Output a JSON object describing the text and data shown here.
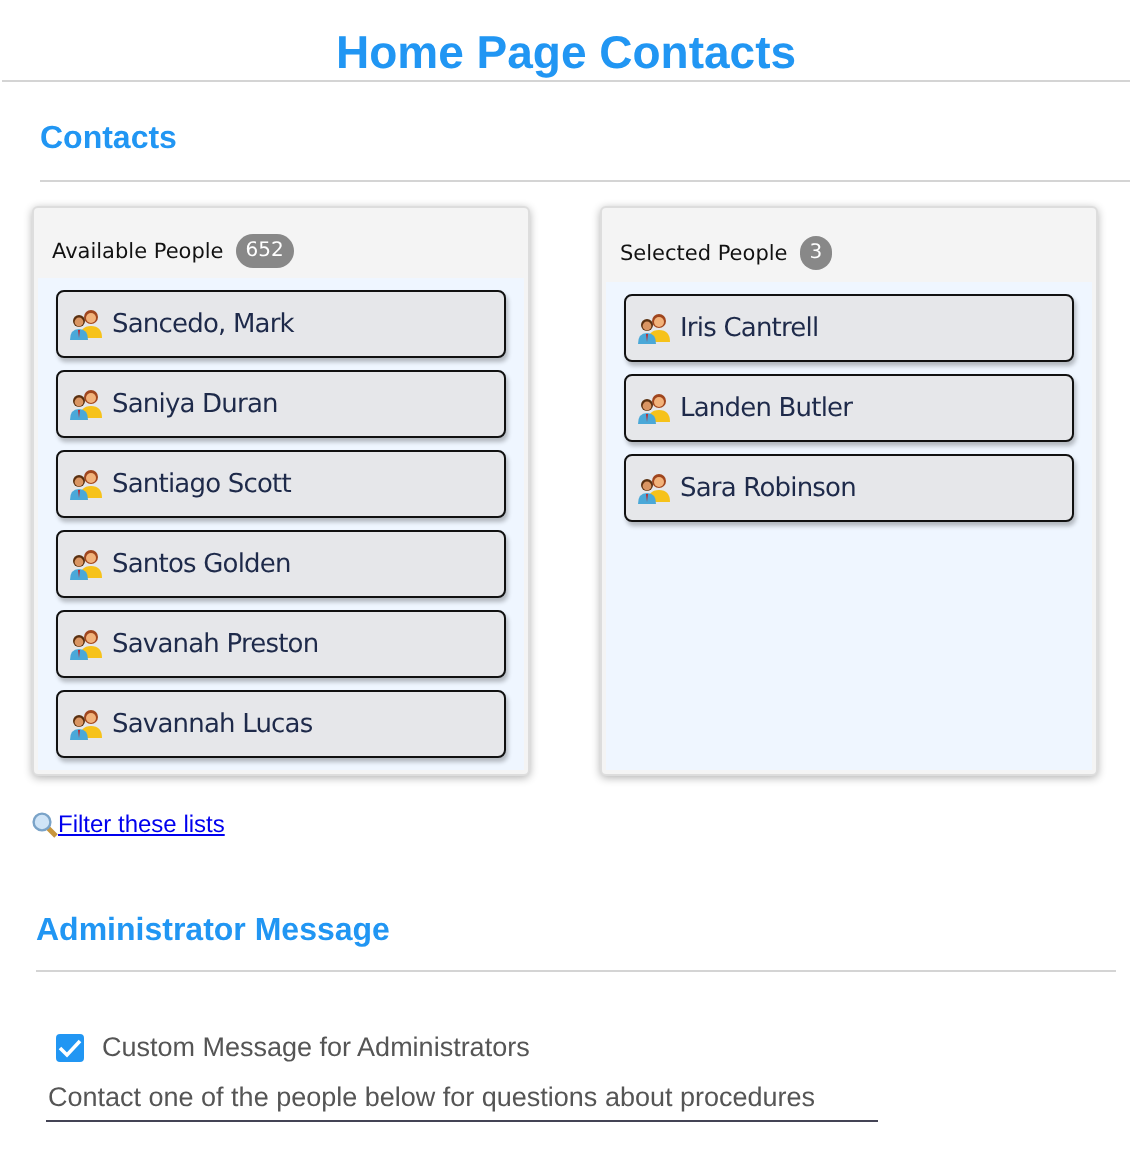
{
  "title": "Home Page Contacts",
  "contacts": {
    "heading": "Contacts",
    "panels": [
      {
        "title": "Available People",
        "count": "652",
        "people": [
          "Sancedo, Mark",
          "Saniya Duran",
          "Santiago Scott",
          "Santos Golden",
          "Savanah Preston",
          "Savannah Lucas"
        ]
      },
      {
        "title": "Selected People",
        "count": "3",
        "people": [
          "Iris Cantrell",
          "Landen Butler",
          "Sara Robinson"
        ]
      }
    ],
    "filter_link": "Filter these lists"
  },
  "admin": {
    "heading": "Administrator Message",
    "checkbox": {
      "label": "Custom Message for Administrators",
      "checked": true
    },
    "message": "Contact one of the people below for questions about procedures"
  }
}
